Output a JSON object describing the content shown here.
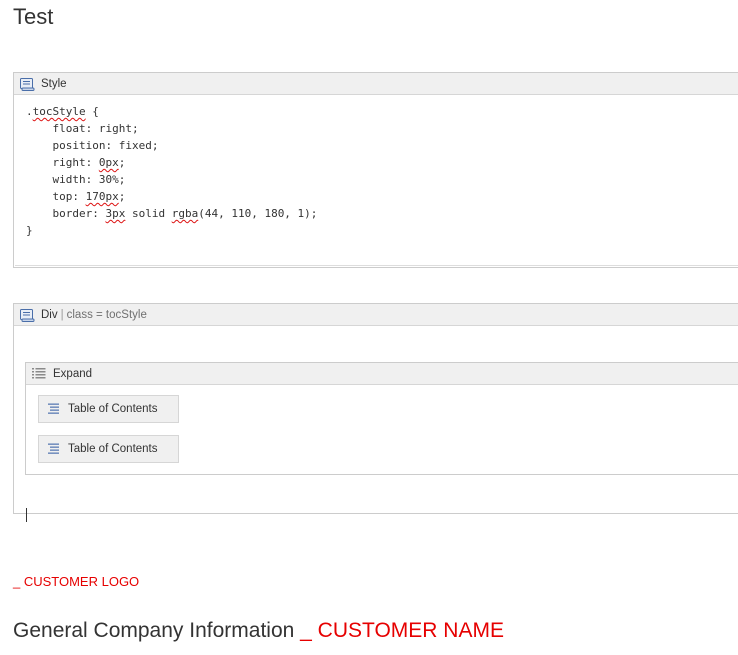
{
  "page": {
    "title": "Test"
  },
  "style_macro": {
    "label": "Style",
    "icon": "macro-scroll-icon",
    "code": {
      "line1_prefix": ".",
      "line1_name": "tocStyle",
      "line1_suffix": " {",
      "line2": "    float: right;",
      "line3": "    position: fixed;",
      "line4_prefix": "    right: ",
      "line4_value": "0px",
      "line4_suffix": ";",
      "line5": "    width: 30%;",
      "line6_prefix": "    top: ",
      "line6_value": "170px",
      "line6_suffix": ";",
      "line7_prefix": "    border: ",
      "line7_value": "3px",
      "line7_middle": " solid ",
      "line7_func": "rgba",
      "line7_suffix": "(44, 110, 180, 1);",
      "line8": "}"
    }
  },
  "div_macro": {
    "label": "Div",
    "separator": "|",
    "param": "class = tocStyle",
    "icon": "macro-scroll-icon"
  },
  "expand_macro": {
    "label": "Expand",
    "icon": "list-icon",
    "items": [
      {
        "label": "Table of Contents",
        "icon": "toc-icon"
      },
      {
        "label": "Table of Contents",
        "icon": "toc-icon"
      }
    ]
  },
  "customer_logo": "_ CUSTOMER LOGO",
  "section_heading": {
    "text": "General Company Information ",
    "placeholder": "_ CUSTOMER NAME"
  },
  "colors": {
    "placeholder_red": "#e60000",
    "macro_header_bg": "#f0f0f0",
    "border": "#cccccc"
  }
}
